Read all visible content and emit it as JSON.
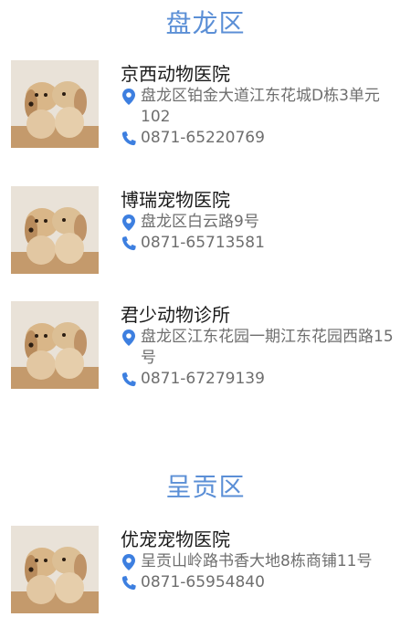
{
  "colors": {
    "accent": "#5b8fd6",
    "icon": "#3d7fe0",
    "text": "#1a1a1a",
    "muted": "#6e6e6e"
  },
  "sections": [
    {
      "district": "盘龙区",
      "clinics": [
        {
          "name": "京西动物医院",
          "address": "盘龙区铂金大道江东花城D栋3单元102",
          "phone": "0871-65220769",
          "image": "puppies-photo"
        },
        {
          "name": "博瑞宠物医院",
          "address": "盘龙区白云路9号",
          "phone": "0871-65713581",
          "image": "puppies-photo"
        },
        {
          "name": "君少动物诊所",
          "address": "盘龙区江东花园一期江东花园西路15号",
          "phone": "0871-67279139",
          "image": "puppies-photo"
        }
      ]
    },
    {
      "district": "呈贡区",
      "clinics": [
        {
          "name": "优宠宠物医院",
          "address": "呈贡山岭路书香大地8栋商铺11号",
          "phone": "0871-65954840",
          "image": "puppies-photo"
        }
      ]
    }
  ]
}
